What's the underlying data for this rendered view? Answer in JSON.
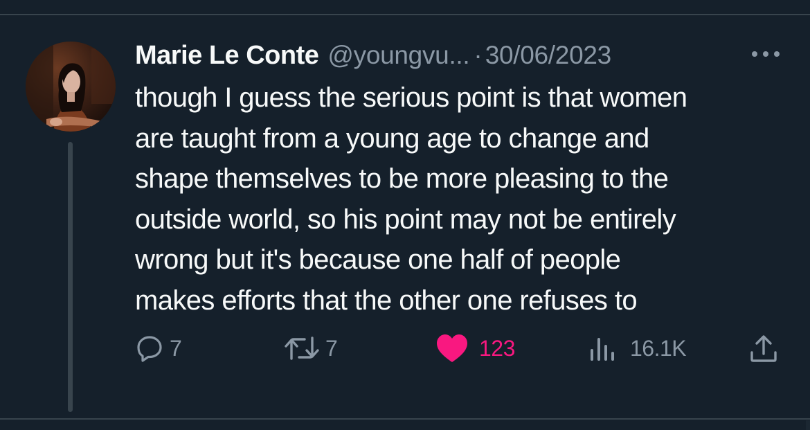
{
  "tweet": {
    "author": {
      "name": "Marie Le Conte",
      "handle": "@youngvu...",
      "avatar_alt": "Profile photo"
    },
    "separator": "·",
    "date": "30/06/2023",
    "text_lines": [
      "though I guess the serious point is that women",
      "are taught from a young age to change and",
      "shape themselves to be more pleasing to the",
      "outside world, so his point may not be entirely",
      "wrong but it's because one half of people",
      "makes efforts that the other one refuses to"
    ],
    "actions": {
      "replies": {
        "icon": "reply-icon",
        "count": "7"
      },
      "retweets": {
        "icon": "retweet-icon",
        "count": "7"
      },
      "likes": {
        "icon": "heart-icon",
        "count": "123",
        "liked": true
      },
      "views": {
        "icon": "views-icon",
        "count": "16.1K"
      },
      "share": {
        "icon": "share-icon"
      }
    },
    "more_icon": "more-options-icon"
  },
  "colors": {
    "background": "#15202b",
    "divider": "#38444d",
    "primary_text": "#f7f9f9",
    "secondary_text": "#8b98a5",
    "like_pink": "#f91880"
  }
}
